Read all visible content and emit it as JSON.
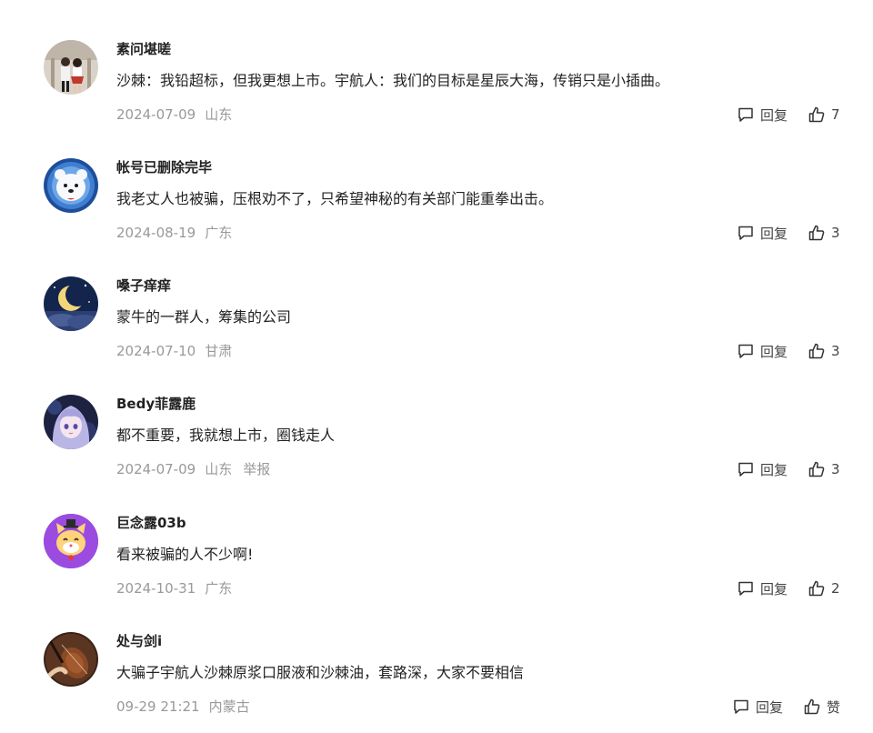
{
  "comments": [
    {
      "username": "素问堪嗟",
      "text": "沙棘：我铅超标，但我更想上市。宇航人：我们的目标是星辰大海，传销只是小插曲。",
      "date": "2024-07-09",
      "location": "山东",
      "reply_label": "回复",
      "likes": "7",
      "avatar_icon": "couple-photo-avatar"
    },
    {
      "username": "帐号已删除完毕",
      "text": "我老丈人也被骗，压根劝不了，只希望神秘的有关部门能重拳出击。",
      "date": "2024-08-19",
      "location": "广东",
      "reply_label": "回复",
      "likes": "3",
      "avatar_icon": "polar-bear-avatar"
    },
    {
      "username": "嗓子痒痒",
      "text": "蒙牛的一群人，筹集的公司",
      "date": "2024-07-10",
      "location": "甘肃",
      "reply_label": "回复",
      "likes": "3",
      "avatar_icon": "crescent-moon-avatar"
    },
    {
      "username": "Bedy菲露鹿",
      "text": "都不重要，我就想上市，圈钱走人",
      "date": "2024-07-09",
      "location": "山东",
      "report_label": "举报",
      "reply_label": "回复",
      "likes": "3",
      "avatar_icon": "anime-girl-avatar"
    },
    {
      "username": "巨念露03b",
      "text": "看来被骗的人不少啊!",
      "date": "2024-10-31",
      "location": "广东",
      "reply_label": "回复",
      "likes": "2",
      "avatar_icon": "cartoon-cat-avatar"
    },
    {
      "username": "处与剑i",
      "text": "大骗子宇航人沙棘原浆口服液和沙棘油，套路深，大家不要相信",
      "date": "09-29 21:21",
      "location": "内蒙古",
      "reply_label": "回复",
      "likes": "赞",
      "avatar_icon": "violin-photo-avatar"
    }
  ],
  "colors": {
    "text_primary": "#222222",
    "text_meta": "#999999",
    "icon_stroke": "#333333"
  }
}
